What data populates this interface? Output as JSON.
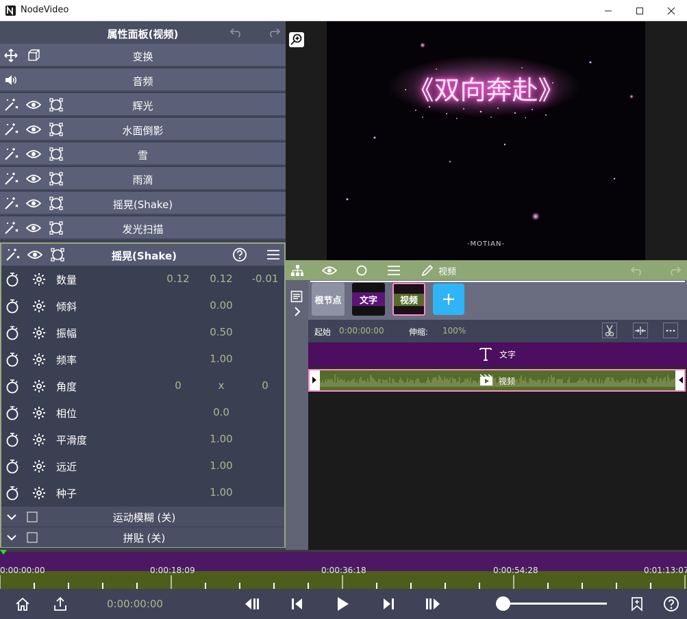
{
  "window": {
    "title": "NodeVideo",
    "controls": [
      "minimize-icon",
      "maximize-icon",
      "close-icon"
    ]
  },
  "properties_panel": {
    "title": "属性面板(视频)",
    "undo_icon": "undo-icon",
    "redo_icon": "redo-icon",
    "rows": [
      {
        "label": "变换",
        "icons": [
          "move-icon",
          "cube-icon"
        ]
      },
      {
        "label": "音频",
        "icons": [
          "speaker-icon"
        ]
      },
      {
        "label": "辉光",
        "icons": [
          "magic-wand-icon",
          "eye-icon",
          "keyframe-icon"
        ]
      },
      {
        "label": "水面倒影",
        "icons": [
          "magic-wand-icon",
          "eye-icon",
          "keyframe-icon"
        ]
      },
      {
        "label": "雪",
        "icons": [
          "magic-wand-icon",
          "eye-icon",
          "keyframe-icon"
        ]
      },
      {
        "label": "雨滴",
        "icons": [
          "magic-wand-icon",
          "eye-icon",
          "keyframe-icon"
        ]
      },
      {
        "label": "摇晃(Shake)",
        "icons": [
          "magic-wand-icon",
          "eye-icon",
          "keyframe-icon"
        ]
      },
      {
        "label": "发光扫描",
        "icons": [
          "magic-wand-icon",
          "eye-icon",
          "keyframe-icon"
        ]
      }
    ],
    "shake": {
      "title": "摇晃(Shake)",
      "params": [
        {
          "label": "数量",
          "values": [
            "0.12",
            "0.12",
            "-0.01"
          ]
        },
        {
          "label": "倾斜",
          "values": [
            "",
            "0.00",
            ""
          ]
        },
        {
          "label": "振幅",
          "values": [
            "",
            "0.50",
            ""
          ]
        },
        {
          "label": "频率",
          "values": [
            "",
            "1.00",
            ""
          ]
        },
        {
          "label": "角度",
          "values": [
            "0",
            "x",
            "0"
          ]
        },
        {
          "label": "相位",
          "values": [
            "",
            "0.0",
            ""
          ]
        },
        {
          "label": "平滑度",
          "values": [
            "",
            "1.00",
            ""
          ]
        },
        {
          "label": "远近",
          "values": [
            "",
            "1.00",
            ""
          ]
        },
        {
          "label": "种子",
          "values": [
            "",
            "1.00",
            ""
          ]
        }
      ],
      "folds": [
        {
          "label": "运动模糊 (关)"
        },
        {
          "label": "拼贴 (关)"
        }
      ]
    }
  },
  "preview": {
    "title_text": "《双向奔赴》",
    "watermark": "-MOTIAN-"
  },
  "timeline": {
    "toolbar_label": "视频",
    "layers": [
      {
        "label": "根节点"
      },
      {
        "label": "文字"
      },
      {
        "label": "视频"
      }
    ],
    "add_icon": "plus-icon",
    "clip_info": {
      "start_label": "起始",
      "start_value": "0:00:00:00",
      "stretch_label": "伸缩:",
      "stretch_value": "100%"
    },
    "text_track_label": "文字",
    "video_track_label": "视频"
  },
  "ruler": {
    "labels": [
      "0:00:00:00",
      "0:00:18:09",
      "0:00:36:18",
      "0:00:54:28",
      "0:01:13:07"
    ]
  },
  "transport": {
    "current_time": "0:00:00:00",
    "zoom_level": 0.0
  },
  "colors": {
    "panel_bg": "#3d4154",
    "row_bg": "#5b5f77",
    "accent_green": "#a9b98e",
    "text_track": "#4c0e5e",
    "video_track": "#556b2a",
    "selection_pink": "#ff8ad0",
    "add_button": "#2fb4f5"
  }
}
